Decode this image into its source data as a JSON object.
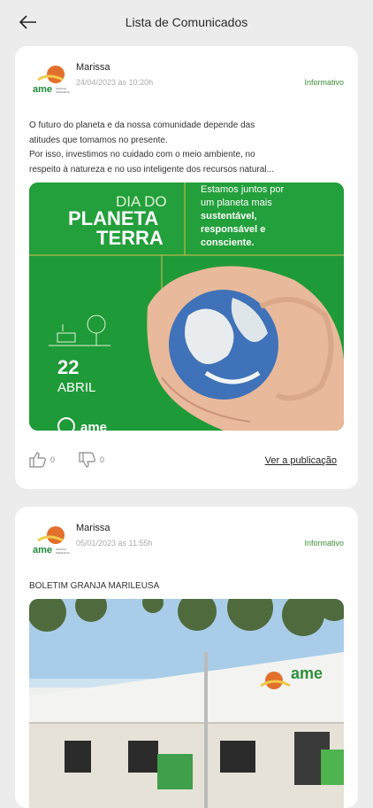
{
  "header": {
    "title": "Lista de Comunicados",
    "back_icon": "arrow-left-icon"
  },
  "posts": [
    {
      "author": "Marissa",
      "date": "24/04/2023 às 10:20h",
      "tag": "Informativo",
      "text_lines": [
        "O futuro do planeta e da nossa comunidade depende das",
        "atitudes que tomamos no presente.",
        "Por isso, investimos no cuidado com o meio ambiente, no",
        "respeito à natureza e no uso inteligente dos recursos natural..."
      ],
      "image": {
        "line1": "DIA DO",
        "line2": "PLANETA",
        "line3": "TERRA",
        "msg1": "Estamos juntos por",
        "msg2": "um planeta mais",
        "msg3": "sustentável,",
        "msg4": "responsável e",
        "msg5": "consciente.",
        "day": "22",
        "month": "ABRIL",
        "brand": "ame"
      },
      "likes": "0",
      "dislikes": "0",
      "view_label": "Ver a publicação"
    },
    {
      "author": "Marissa",
      "date": "05/01/2023 às 11:55h",
      "tag": "Informativo",
      "heading": "BOLETIM GRANJA MARILEUSA",
      "image": {
        "brand": "ame"
      }
    }
  ],
  "colors": {
    "accent_green": "#3f8f3a",
    "poster_green": "#1f9a38",
    "logo_orange": "#e2702c",
    "logo_yellow": "#f3c94b"
  }
}
